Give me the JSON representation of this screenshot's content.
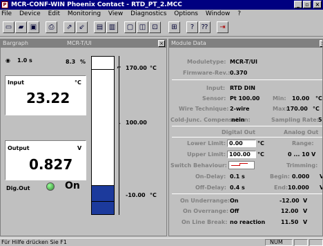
{
  "window": {
    "title": "MCR-CONF-WIN Phoenix Contact - RTD_PT_2.MCC",
    "app_icon": "P"
  },
  "menu": [
    "File",
    "Device",
    "Edit",
    "Monitoring",
    "View",
    "Diagnostics",
    "Options",
    "Window",
    "?"
  ],
  "toolbar_icons": [
    "new-icon",
    "open-icon",
    "save-icon",
    "print-icon",
    "upload-icon",
    "download-icon",
    "monitor-icon",
    "compare-icon",
    "window1-icon",
    "window2-icon",
    "window3-icon",
    "device-icon",
    "help-icon",
    "context-help-icon",
    "exit-icon"
  ],
  "bargraph": {
    "title": "Bargraph",
    "title_right": "MCR-T/UI",
    "period": "1.0 s",
    "percent": "8.3",
    "percent_unit": "%",
    "input_label": "Input",
    "input_unit": "°C",
    "input_value": "23.22",
    "output_label": "Output",
    "output_unit": "V",
    "output_value": "0.827",
    "digout_label": "Dig.Out",
    "digout_value": "On",
    "scale_top": "170.00",
    "scale_top_unit": "°C",
    "scale_mid": "100.00",
    "scale_bottom": "-10.00",
    "scale_bottom_unit": "°C",
    "bar_fill_fraction": 0.183
  },
  "module": {
    "title": "Module Data",
    "moduletype_label": "Moduletype:",
    "moduletype": "MCR-T/UI",
    "firmware_label": "Firmware-Rev.:",
    "firmware": "0.370",
    "input_label": "Input:",
    "input": "RTD DIN",
    "sensor_label": "Sensor:",
    "sensor": "Pt 100.00",
    "min_label": "Min:",
    "min": "10.00",
    "min_unit": "°C",
    "wire_label": "Wire Technique:",
    "wire": "2-wire",
    "max_label": "Max:",
    "max": "170.00",
    "max_unit": "°C",
    "cjc_label": "Cold-Junc. Compensation:",
    "cjc": "nein",
    "sampling_label": "Sampling Rate:",
    "sampling": "5",
    "digital_out": "Digital Out",
    "analog_out": "Analog Out",
    "lower_label": "Lower Limit:",
    "lower": "0.00",
    "lower_unit": "°C",
    "range_label": "Range:",
    "upper_label": "Upper Limit:",
    "upper": "100.00",
    "upper_unit": "°C",
    "range": "0 ... 10 V",
    "switch_label": "Switch Behaviour:",
    "trimming_label": "Trimming:",
    "ondelay_label": "On-Delay:",
    "ondelay": "0.1 s",
    "begin_label": "Begin:",
    "begin": "0.000",
    "begin_unit": "V",
    "offdelay_label": "Off-Delay:",
    "offdelay": "0.4 s",
    "end_label": "End:",
    "end": "10.000",
    "end_unit": "V",
    "onunder_label": "On Underrange:",
    "onunder": "On",
    "onunder_v": "-12.00",
    "onunder_unit": "V",
    "onover_label": "On Overrange:",
    "onover": "Off",
    "onover_v": "12.00",
    "onover_unit": "V",
    "onbreak_label": "On Line Break:",
    "onbreak": "no reaction",
    "onbreak_v": "11.50",
    "onbreak_unit": "V"
  },
  "status": {
    "text": "Für Hilfe drücken Sie F1",
    "num": "NUM"
  },
  "colors": {
    "titlebar": "#000080",
    "bar": "#1c3a9c",
    "led": "#2e8b2e"
  }
}
